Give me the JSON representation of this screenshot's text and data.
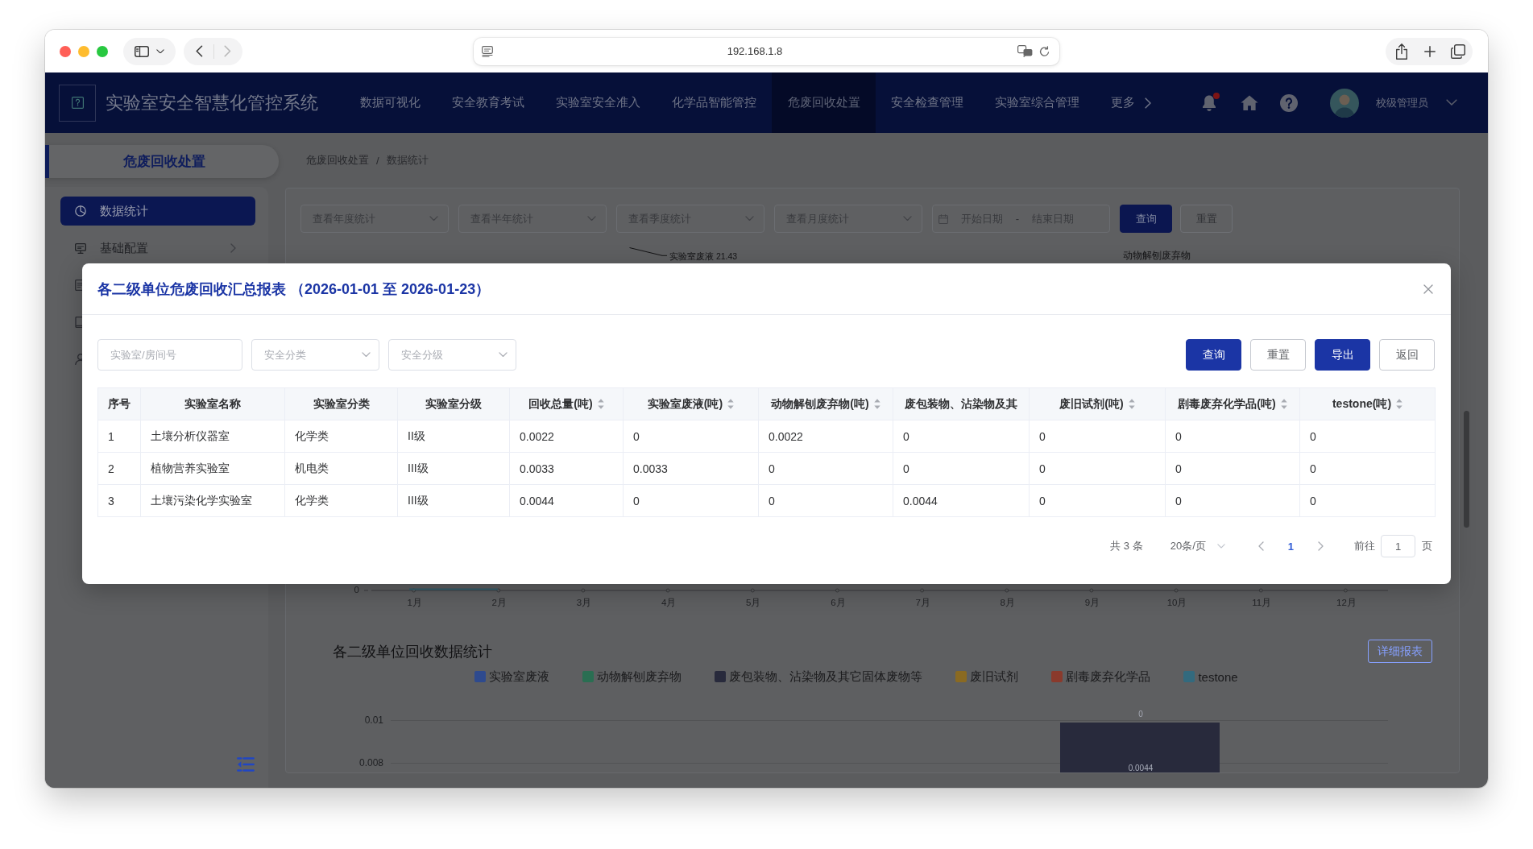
{
  "browser": {
    "url": "192.168.1.8",
    "back": {
      "disabled": false
    },
    "forward": {
      "disabled": true
    }
  },
  "header": {
    "title": "实验室安全智慧化管控系统",
    "nav": [
      {
        "label": "数据可视化",
        "kind": "link",
        "selected": false
      },
      {
        "label": "安全教育考试",
        "kind": "link",
        "selected": false
      },
      {
        "label": "实验室安全准入",
        "kind": "link",
        "selected": false
      },
      {
        "label": "化学品智能管控",
        "kind": "link",
        "selected": false
      },
      {
        "label": "危废回收处置",
        "kind": "link",
        "selected": true
      },
      {
        "label": "安全检查管理",
        "kind": "link",
        "selected": false
      },
      {
        "label": "实验室综合管理",
        "kind": "link",
        "selected": false
      },
      {
        "label": "更多",
        "kind": "more",
        "selected": false
      }
    ],
    "unread": true,
    "user": "校级管理员"
  },
  "sidebar": {
    "title": "危废回收处置",
    "items": [
      {
        "label": "数据统计",
        "kind": "chart",
        "selected": true,
        "expandable": false
      },
      {
        "label": "基础配置",
        "kind": "monitor",
        "selected": false,
        "expandable": true
      },
      {
        "kind": "document",
        "selected": false
      },
      {
        "kind": "book",
        "selected": false
      },
      {
        "kind": "person",
        "selected": false
      }
    ]
  },
  "breadcrumb": {
    "items": [
      "危废回收处置",
      "数据统计"
    ],
    "separator": "/"
  },
  "filters": {
    "selects": [
      {
        "placeholder": "查看年度统计"
      },
      {
        "placeholder": "查看半年统计"
      },
      {
        "placeholder": "查看季度统计"
      },
      {
        "placeholder": "查看月度统计"
      }
    ],
    "date_range": {
      "start_placeholder": "开始日期",
      "separator": "-",
      "end_placeholder": "结束日期"
    },
    "buttons": [
      {
        "label": "查询",
        "kind": "primary"
      },
      {
        "label": "重置",
        "kind": "default"
      }
    ]
  },
  "summary_chart": {
    "labels": [
      {
        "text": "实验室废液 21.43",
        "kind": "leader"
      },
      {
        "text": "动物解刨废弃物",
        "kind": "plain"
      }
    ]
  },
  "monthly_chart": {
    "y_tick": "0",
    "x_labels": [
      "1月",
      "2月",
      "3月",
      "4月",
      "5月",
      "6月",
      "7月",
      "8月",
      "9月",
      "10月",
      "11月",
      "12月"
    ]
  },
  "unit_chart": {
    "title": "各二级单位回收数据统计",
    "button": "详细报表",
    "legend": [
      {
        "name": "实验室废液",
        "color": "#2e4a8e"
      },
      {
        "name": "动物解刨废弃物",
        "color": "#2a6e52"
      },
      {
        "name": "废包装物、沾染物及其它固体废物等",
        "color": "#282a3c"
      },
      {
        "name": "废旧试剂",
        "color": "#8a6a22"
      },
      {
        "name": "剧毒废弃化学品",
        "color": "#8a3a2c"
      },
      {
        "name": "testone",
        "color": "#336a7e"
      }
    ],
    "y_ticks": [
      "0.01",
      "0.008"
    ],
    "bar": {
      "color": "#282a3c",
      "top_label": "0",
      "label": "0.0044"
    }
  },
  "modal": {
    "title": "各二级单位危废回收汇总报表 （2026-01-01 至 2026-01-23）",
    "filters": [
      {
        "kind": "input",
        "placeholder": "实验室/房间号"
      },
      {
        "kind": "select",
        "placeholder": "安全分类"
      },
      {
        "kind": "select",
        "placeholder": "安全分级"
      }
    ],
    "buttons": [
      {
        "label": "查询",
        "kind": "primary"
      },
      {
        "label": "重置",
        "kind": "default"
      },
      {
        "label": "导出",
        "kind": "primary"
      },
      {
        "label": "返回",
        "kind": "default"
      }
    ],
    "table": {
      "columns": [
        {
          "label": "序号",
          "sortable": false
        },
        {
          "label": "实验室名称",
          "sortable": false
        },
        {
          "label": "实验室分类",
          "sortable": false
        },
        {
          "label": "实验室分级",
          "sortable": false
        },
        {
          "label": "回收总量(吨)",
          "sortable": true
        },
        {
          "label": "实验室废液(吨)",
          "sortable": true
        },
        {
          "label": "动物解刨废弃物(吨)",
          "sortable": true
        },
        {
          "label": "废包装物、沾染物及其",
          "sortable": false
        },
        {
          "label": "废旧试剂(吨)",
          "sortable": true
        },
        {
          "label": "剧毒废弃化学品(吨)",
          "sortable": true
        },
        {
          "label": "testone(吨)",
          "sortable": true
        }
      ],
      "rows": [
        [
          "1",
          "土壤分析仪器室",
          "化学类",
          "II级",
          "0.0022",
          "0",
          "0.0022",
          "0",
          "0",
          "0",
          "0"
        ],
        [
          "2",
          "植物营养实验室",
          "机电类",
          "III级",
          "0.0033",
          "0.0033",
          "0",
          "0",
          "0",
          "0",
          "0"
        ],
        [
          "3",
          "土壤污染化学实验室",
          "化学类",
          "III级",
          "0.0044",
          "0",
          "0",
          "0.0044",
          "0",
          "0",
          "0"
        ]
      ]
    },
    "pagination": {
      "total": "共 3 条",
      "page_size": "20条/页",
      "prev": {
        "disabled": true
      },
      "pages": [
        {
          "label": "1",
          "selected": true
        }
      ],
      "next": {
        "disabled": true
      },
      "goto_label": "前往",
      "goto_value": "1",
      "goto_suffix": "页"
    }
  }
}
